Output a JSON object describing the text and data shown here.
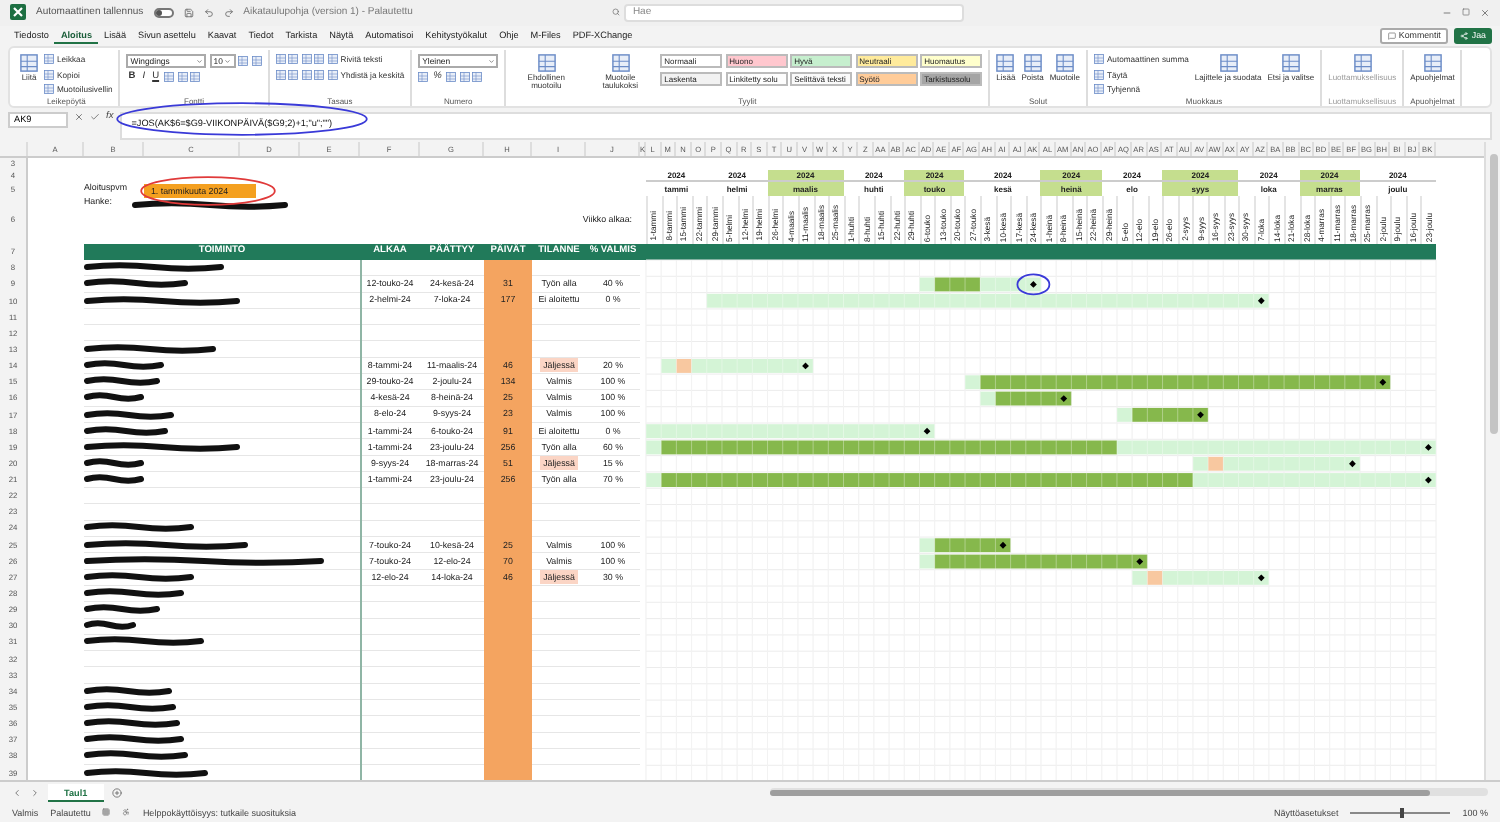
{
  "title_bar": {
    "autosave_label": "Automaattinen tallennus",
    "autosave_on": false,
    "document_title": "Aikataulupohja (version 1) - Palautettu",
    "search_placeholder": "Hae"
  },
  "menu_tabs": [
    {
      "label": "Tiedosto",
      "selected": false
    },
    {
      "label": "Aloitus",
      "selected": true
    },
    {
      "label": "Lisää",
      "selected": false
    },
    {
      "label": "Sivun asettelu",
      "selected": false
    },
    {
      "label": "Kaavat",
      "selected": false
    },
    {
      "label": "Tiedot",
      "selected": false
    },
    {
      "label": "Tarkista",
      "selected": false
    },
    {
      "label": "Näytä",
      "selected": false
    },
    {
      "label": "Automatisoi",
      "selected": false
    },
    {
      "label": "Kehitystyökalut",
      "selected": false
    },
    {
      "label": "Ohje",
      "selected": false
    },
    {
      "label": "M-Files",
      "selected": false
    },
    {
      "label": "PDF-XChange",
      "selected": false
    }
  ],
  "share_buttons": [
    {
      "label": "Kommentit",
      "kind": "outline"
    },
    {
      "label": "Jaa",
      "kind": "primary"
    }
  ],
  "ribbon": [
    {
      "label": "Leikepöytä",
      "disabled": false,
      "stacks": [
        [
          {
            "kind": "big",
            "label": "Liitä"
          }
        ],
        [
          {
            "kind": "small",
            "label": "Leikkaa"
          },
          {
            "kind": "small",
            "label": "Kopioi"
          },
          {
            "kind": "small",
            "label": "Muotoilusivellin"
          }
        ]
      ]
    },
    {
      "label": "Fontti",
      "disabled": false,
      "lines": [
        [
          {
            "kind": "combo",
            "label": "Wingdings"
          },
          {
            "kind": "combo",
            "label": "10"
          },
          {
            "kind": "icon"
          },
          {
            "kind": "icon"
          }
        ],
        [
          {
            "kind": "letter",
            "label": "B"
          },
          {
            "kind": "letter",
            "label": "I"
          },
          {
            "kind": "letter",
            "label": "U"
          },
          {
            "kind": "icon"
          },
          {
            "kind": "icon"
          },
          {
            "kind": "icon"
          }
        ]
      ]
    },
    {
      "label": "Tasaus",
      "disabled": false,
      "lines": [
        [
          {
            "kind": "icon"
          },
          {
            "kind": "icon"
          },
          {
            "kind": "icon"
          },
          {
            "kind": "icon"
          },
          {
            "kind": "small",
            "label": "Rivitä teksti"
          }
        ],
        [
          {
            "kind": "icon"
          },
          {
            "kind": "icon"
          },
          {
            "kind": "icon"
          },
          {
            "kind": "icon"
          },
          {
            "kind": "small",
            "label": "Yhdistä ja keskitä"
          }
        ]
      ]
    },
    {
      "label": "Numero",
      "disabled": false,
      "lines": [
        [
          {
            "kind": "combo",
            "label": "Yleinen"
          }
        ],
        [
          {
            "kind": "icon"
          },
          {
            "kind": "letter",
            "label": "%"
          },
          {
            "kind": "icon"
          },
          {
            "kind": "icon"
          },
          {
            "kind": "icon"
          }
        ]
      ]
    },
    {
      "label": "Tyylit",
      "disabled": false,
      "stacks": [
        [
          {
            "kind": "big",
            "label": "Ehdollinen muotoilu"
          }
        ],
        [
          {
            "kind": "big",
            "label": "Muotoile taulukoksi"
          }
        ],
        [
          {
            "kind": "styles",
            "styles": [
              {
                "label": "Normaali",
                "color": "#ffffff"
              },
              {
                "label": "Huono",
                "color": "#ffc7ce"
              },
              {
                "label": "Hyvä",
                "color": "#c6efce"
              },
              {
                "label": "Neutraali",
                "color": "#ffeb9c"
              },
              {
                "label": "Huomautus",
                "color": "#ffffcc"
              },
              {
                "label": "Laskenta",
                "color": "#f2f2f2"
              },
              {
                "label": "Linkitetty solu",
                "color": "#fdfdfd"
              },
              {
                "label": "Selittävä teksti",
                "color": "#fafafa"
              },
              {
                "label": "Syötö",
                "color": "#ffcc99"
              },
              {
                "label": "Tarkistussolu",
                "color": "#a5a5a5"
              }
            ]
          }
        ]
      ]
    },
    {
      "label": "Solut",
      "disabled": false,
      "stacks": [
        [
          {
            "kind": "big",
            "label": "Lisää"
          }
        ],
        [
          {
            "kind": "big",
            "label": "Poista"
          }
        ],
        [
          {
            "kind": "big",
            "label": "Muotoile"
          }
        ]
      ]
    },
    {
      "label": "Muokkaus",
      "disabled": false,
      "stacks": [
        [
          {
            "kind": "small",
            "label": "Automaattinen summa"
          },
          {
            "kind": "small",
            "label": "Täytä"
          },
          {
            "kind": "small",
            "label": "Tyhjennä"
          }
        ],
        [
          {
            "kind": "big",
            "label": "Lajittele ja suodata"
          }
        ],
        [
          {
            "kind": "big",
            "label": "Etsi ja valitse"
          }
        ]
      ]
    },
    {
      "label": "Luottamuksellisuus",
      "disabled": true,
      "stacks": [
        [
          {
            "kind": "big",
            "label": "Luottamuksellisuus"
          }
        ]
      ]
    },
    {
      "label": "Apuohjelmat",
      "disabled": false,
      "stacks": [
        [
          {
            "kind": "big",
            "label": "Apuohjelmat"
          }
        ]
      ]
    }
  ],
  "formula_bar": {
    "cell": "AK9",
    "function_label": "fx",
    "formula": "=JOS(AK$6=$G9-VIIKONPÄIVÄ($G9;2)+1;\"u\";\"\")",
    "circled": true
  },
  "sheet": {
    "column_letters": [
      "A",
      "B",
      "C",
      "D",
      "E",
      "F",
      "G",
      "H",
      "I",
      "J",
      "K"
    ],
    "gantt_letters": [
      "L",
      "M",
      "N",
      "O",
      "P",
      "Q",
      "R",
      "S",
      "T",
      "U",
      "V",
      "W",
      "X",
      "Y",
      "Z",
      "AA",
      "AB",
      "AC",
      "AD",
      "AE",
      "AF",
      "AG",
      "AH",
      "AI",
      "AJ",
      "AK",
      "AL",
      "AM",
      "AN",
      "AO",
      "AP",
      "AQ",
      "AR",
      "AS",
      "AT",
      "AU",
      "AV",
      "AW",
      "AX",
      "AY",
      "AZ",
      "BA",
      "BB",
      "BC",
      "BD",
      "BE",
      "BF",
      "BG",
      "BH",
      "BI",
      "BJ",
      "BK"
    ],
    "header_row_numbers": [
      "3",
      "4",
      "5",
      "6",
      "7"
    ],
    "start_label": "Aloituspvm",
    "start_value": "1. tammikuuta 2024",
    "start_circled": true,
    "project_label": "Hanke:",
    "week_label": "Viikko alkaa:"
  },
  "months": [
    {
      "year": "2024",
      "name": "tammi",
      "highlighted": false,
      "weeks": [
        "1-tammi",
        "8-tammi",
        "15-tammi",
        "22-tammi"
      ]
    },
    {
      "year": "2024",
      "name": "helmi",
      "highlighted": false,
      "weeks": [
        "29-tammi",
        "5-helmi",
        "12-helmi",
        "19-helmi"
      ]
    },
    {
      "year": "2024",
      "name": "maalis",
      "highlighted": true,
      "weeks": [
        "26-helmi",
        "4-maalis",
        "11-maalis",
        "18-maalis",
        "25-maalis"
      ]
    },
    {
      "year": "2024",
      "name": "huhti",
      "highlighted": false,
      "weeks": [
        "1-huhti",
        "8-huhti",
        "15-huhti",
        "22-huhti"
      ]
    },
    {
      "year": "2024",
      "name": "touko",
      "highlighted": true,
      "weeks": [
        "29-huhti",
        "6-touko",
        "13-touko",
        "20-touko"
      ]
    },
    {
      "year": "2024",
      "name": "kesä",
      "highlighted": false,
      "weeks": [
        "27-touko",
        "3-kesä",
        "10-kesä",
        "17-kesä",
        "24-kesä"
      ]
    },
    {
      "year": "2024",
      "name": "heinä",
      "highlighted": true,
      "weeks": [
        "1-heinä",
        "8-heinä",
        "15-heinä",
        "22-heinä"
      ]
    },
    {
      "year": "2024",
      "name": "elo",
      "highlighted": false,
      "weeks": [
        "29-heinä",
        "5-elo",
        "12-elo",
        "19-elo"
      ]
    },
    {
      "year": "2024",
      "name": "syys",
      "highlighted": true,
      "weeks": [
        "26-elo",
        "2-syys",
        "9-syys",
        "16-syys",
        "23-syys"
      ]
    },
    {
      "year": "2024",
      "name": "loka",
      "highlighted": false,
      "weeks": [
        "30-syys",
        "7-loka",
        "14-loka",
        "21-loka"
      ]
    },
    {
      "year": "2024",
      "name": "marras",
      "highlighted": true,
      "weeks": [
        "28-loka",
        "4-marras",
        "11-marras",
        "18-marras"
      ]
    },
    {
      "year": "2024",
      "name": "joulu",
      "highlighted": false,
      "weeks": [
        "25-marras",
        "2-joulu",
        "9-joulu",
        "16-joulu",
        "23-joulu"
      ]
    }
  ],
  "table": {
    "columns": [
      "TOIMINTO",
      "ALKAA",
      "PÄÄTTYY",
      "PÄIVÄT",
      "TILANNE",
      "% VALMIS"
    ],
    "rows": [
      {
        "number": "8",
        "redacted": true
      },
      {
        "number": "9",
        "redacted": true,
        "start": "12-touko-24",
        "end": "24-kesä-24",
        "days": "31",
        "status": "Työn alla",
        "kind": "in_progress",
        "percent": "40 %"
      },
      {
        "number": "10",
        "redacted": true,
        "start": "2-helmi-24",
        "end": "7-loka-24",
        "days": "177",
        "status": "Ei aloitettu",
        "kind": "not_started",
        "percent": "0 %"
      },
      {
        "number": "11",
        "redacted": false
      },
      {
        "number": "12",
        "redacted": false
      },
      {
        "number": "13",
        "redacted": true
      },
      {
        "number": "14",
        "redacted": true,
        "start": "8-tammi-24",
        "end": "11-maalis-24",
        "days": "46",
        "status": "Jäljessä",
        "kind": "late",
        "percent": "20 %"
      },
      {
        "number": "15",
        "redacted": true,
        "start": "29-touko-24",
        "end": "2-joulu-24",
        "days": "134",
        "status": "Valmis",
        "kind": "done",
        "percent": "100 %"
      },
      {
        "number": "16",
        "redacted": true,
        "start": "4-kesä-24",
        "end": "8-heinä-24",
        "days": "25",
        "status": "Valmis",
        "kind": "done",
        "percent": "100 %"
      },
      {
        "number": "17",
        "redacted": true,
        "start": "8-elo-24",
        "end": "9-syys-24",
        "days": "23",
        "status": "Valmis",
        "kind": "done",
        "percent": "100 %"
      },
      {
        "number": "18",
        "redacted": true,
        "start": "1-tammi-24",
        "end": "6-touko-24",
        "days": "91",
        "status": "Ei aloitettu",
        "kind": "not_started",
        "percent": "0 %"
      },
      {
        "number": "19",
        "redacted": true,
        "start": "1-tammi-24",
        "end": "23-joulu-24",
        "days": "256",
        "status": "Työn alla",
        "kind": "in_progress",
        "percent": "60 %"
      },
      {
        "number": "20",
        "redacted": true,
        "start": "9-syys-24",
        "end": "18-marras-24",
        "days": "51",
        "status": "Jäljessä",
        "kind": "late",
        "percent": "15 %"
      },
      {
        "number": "21",
        "redacted": true,
        "start": "1-tammi-24",
        "end": "23-joulu-24",
        "days": "256",
        "status": "Työn alla",
        "kind": "in_progress",
        "percent": "70 %"
      },
      {
        "number": "22",
        "redacted": false
      },
      {
        "number": "23",
        "redacted": false
      },
      {
        "number": "24",
        "redacted": true
      },
      {
        "number": "25",
        "redacted": true,
        "start": "7-touko-24",
        "end": "10-kesä-24",
        "days": "25",
        "status": "Valmis",
        "kind": "done",
        "percent": "100 %"
      },
      {
        "number": "26",
        "redacted": true,
        "start": "7-touko-24",
        "end": "12-elo-24",
        "days": "70",
        "status": "Valmis",
        "kind": "done",
        "percent": "100 %"
      },
      {
        "number": "27",
        "redacted": true,
        "start": "12-elo-24",
        "end": "14-loka-24",
        "days": "46",
        "status": "Jäljessä",
        "kind": "late",
        "percent": "30 %"
      },
      {
        "number": "28",
        "redacted": true
      },
      {
        "number": "29",
        "redacted": true
      },
      {
        "number": "30",
        "redacted": true
      },
      {
        "number": "31",
        "redacted": true
      },
      {
        "number": "32",
        "redacted": false
      },
      {
        "number": "33",
        "redacted": false
      },
      {
        "number": "34",
        "redacted": true
      },
      {
        "number": "35",
        "redacted": true
      },
      {
        "number": "36",
        "redacted": true
      },
      {
        "number": "37",
        "redacted": true
      },
      {
        "number": "38",
        "redacted": true
      },
      {
        "number": "39",
        "redacted": true
      }
    ]
  },
  "sheet_tabs": [
    {
      "label": "Taul1",
      "selected": true
    }
  ],
  "status_bar": {
    "left": [
      "Valmis",
      "Palautettu"
    ],
    "accessibility": "Helppokäyttöisyys: tutkaile suosituksia",
    "display": "Näyttöasetukset",
    "zoom_slider": {
      "level": 0.5
    },
    "zoom": "100 %"
  }
}
